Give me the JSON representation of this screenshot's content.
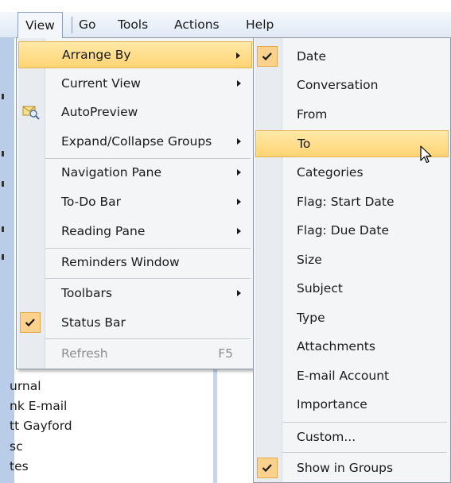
{
  "menubar": {
    "items": [
      {
        "label": "View"
      },
      {
        "label": "Go"
      },
      {
        "label": "Tools"
      },
      {
        "label": "Actions"
      },
      {
        "label": "Help"
      }
    ]
  },
  "left_pane": {
    "fragments": [
      "urnal",
      "nk E-mail",
      "tt Gayford",
      "sc",
      "tes"
    ]
  },
  "view_menu": {
    "items": [
      {
        "label": "Arrange By",
        "submenu": true,
        "highlighted": true
      },
      {
        "label": "Current View",
        "submenu": true
      },
      {
        "label": "AutoPreview",
        "icon": "autopreview-icon"
      },
      {
        "label": "Expand/Collapse Groups",
        "submenu": true
      },
      {
        "label": "Navigation Pane",
        "submenu": true
      },
      {
        "label": "To-Do Bar",
        "submenu": true
      },
      {
        "label": "Reading Pane",
        "submenu": true
      },
      {
        "label": "Reminders Window"
      },
      {
        "label": "Toolbars",
        "submenu": true
      },
      {
        "label": "Status Bar",
        "checked": true
      },
      {
        "label": "Refresh",
        "shortcut": "F5",
        "disabled": true
      }
    ]
  },
  "arrange_menu": {
    "items": [
      {
        "label": "Date",
        "checked": true
      },
      {
        "label": "Conversation"
      },
      {
        "label": "From"
      },
      {
        "label": "To",
        "highlighted": true
      },
      {
        "label": "Categories"
      },
      {
        "label": "Flag: Start Date"
      },
      {
        "label": "Flag: Due Date"
      },
      {
        "label": "Size"
      },
      {
        "label": "Subject"
      },
      {
        "label": "Type"
      },
      {
        "label": "Attachments"
      },
      {
        "label": "E-mail Account"
      },
      {
        "label": "Importance"
      },
      {
        "label": "Custom..."
      },
      {
        "label": "Show in Groups",
        "checked": true
      }
    ]
  },
  "colors": {
    "highlight": "#ffd474",
    "check_bg": "#fbd28d",
    "menubar": "#dfe9f5"
  }
}
